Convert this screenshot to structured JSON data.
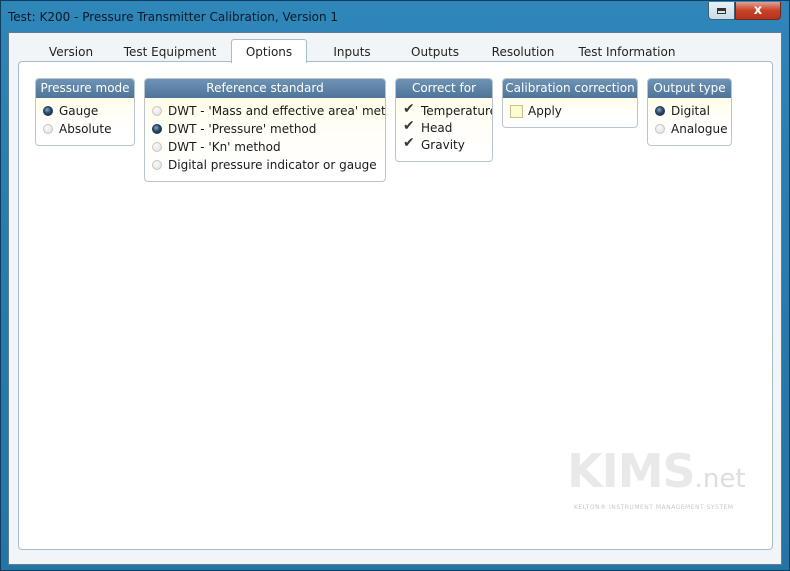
{
  "window": {
    "title": "Test: K200 - Pressure Transmitter Calibration, Version 1"
  },
  "caption_buttons": {
    "close_label": "x"
  },
  "tabs": [
    {
      "label": "Version"
    },
    {
      "label": "Test Equipment"
    },
    {
      "label": "Options",
      "active": true
    },
    {
      "label": "Inputs"
    },
    {
      "label": "Outputs"
    },
    {
      "label": "Resolution"
    },
    {
      "label": "Test Information"
    }
  ],
  "groups": {
    "pressure_mode": {
      "title": "Pressure mode",
      "options": [
        {
          "label": "Gauge",
          "selected": true
        },
        {
          "label": "Absolute",
          "selected": false
        }
      ]
    },
    "reference_standard": {
      "title": "Reference standard",
      "options": [
        {
          "label": "DWT - 'Mass and effective area' method",
          "selected": false
        },
        {
          "label": "DWT - 'Pressure' method",
          "selected": true
        },
        {
          "label": "DWT - 'Kn' method",
          "selected": false
        },
        {
          "label": "Digital pressure indicator or gauge",
          "selected": false
        }
      ]
    },
    "correct_for": {
      "title": "Correct for",
      "options": [
        {
          "label": "Temperature",
          "checked": true
        },
        {
          "label": "Head",
          "checked": true
        },
        {
          "label": "Gravity",
          "checked": true
        }
      ]
    },
    "calibration_correction": {
      "title": "Calibration correction",
      "options": [
        {
          "label": "Apply",
          "checked": false
        }
      ]
    },
    "output_type": {
      "title": "Output type",
      "options": [
        {
          "label": "Digital",
          "selected": true
        },
        {
          "label": "Analogue",
          "selected": false
        }
      ]
    }
  },
  "watermark": {
    "logo_main": "KIMS",
    "logo_suffix": ".net",
    "tagline": "KELTON® INSTRUMENT MANAGEMENT SYSTEM"
  },
  "colors": {
    "titlebar": "#2a7eb0",
    "group_header": "#5a7fa3",
    "close_button": "#c7442b",
    "option_background": "#fffde6"
  }
}
